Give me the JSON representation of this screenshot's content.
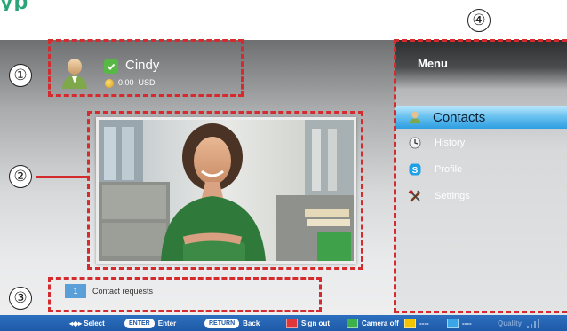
{
  "logo_fragment": "yp",
  "user": {
    "name": "Cindy",
    "balance_amount": "0.00",
    "balance_currency": "USD",
    "status": "online"
  },
  "menu": {
    "title": "Menu",
    "items": [
      {
        "label": "Contacts",
        "icon": "contacts-icon",
        "selected": true
      },
      {
        "label": "History",
        "icon": "clock-icon",
        "selected": false
      },
      {
        "label": "Profile",
        "icon": "skype-icon",
        "selected": false
      },
      {
        "label": "Settings",
        "icon": "tools-icon",
        "selected": false
      }
    ]
  },
  "contact_requests": {
    "count": "1",
    "label": "Contact requests"
  },
  "bottom_bar": {
    "select_label": "Select",
    "enter_key": "ENTER",
    "enter_label": "Enter",
    "return_key": "RETURN",
    "back_label": "Back",
    "red_label": "Sign out",
    "green_label": "Camera off",
    "yellow_label": "----",
    "blue_label": "----",
    "quality_label": "Quality"
  },
  "annotations": [
    "①",
    "②",
    "③",
    "④"
  ],
  "colors": {
    "annotation_red": "#d42b2f",
    "menu_selected": "#2d9ee2",
    "status_green": "#58b845",
    "bottom_bar": "#1e5aa7",
    "key_red": "#e0373a",
    "key_green": "#3fb14a",
    "key_yellow": "#f5c400",
    "key_blue": "#3aa6e6"
  }
}
